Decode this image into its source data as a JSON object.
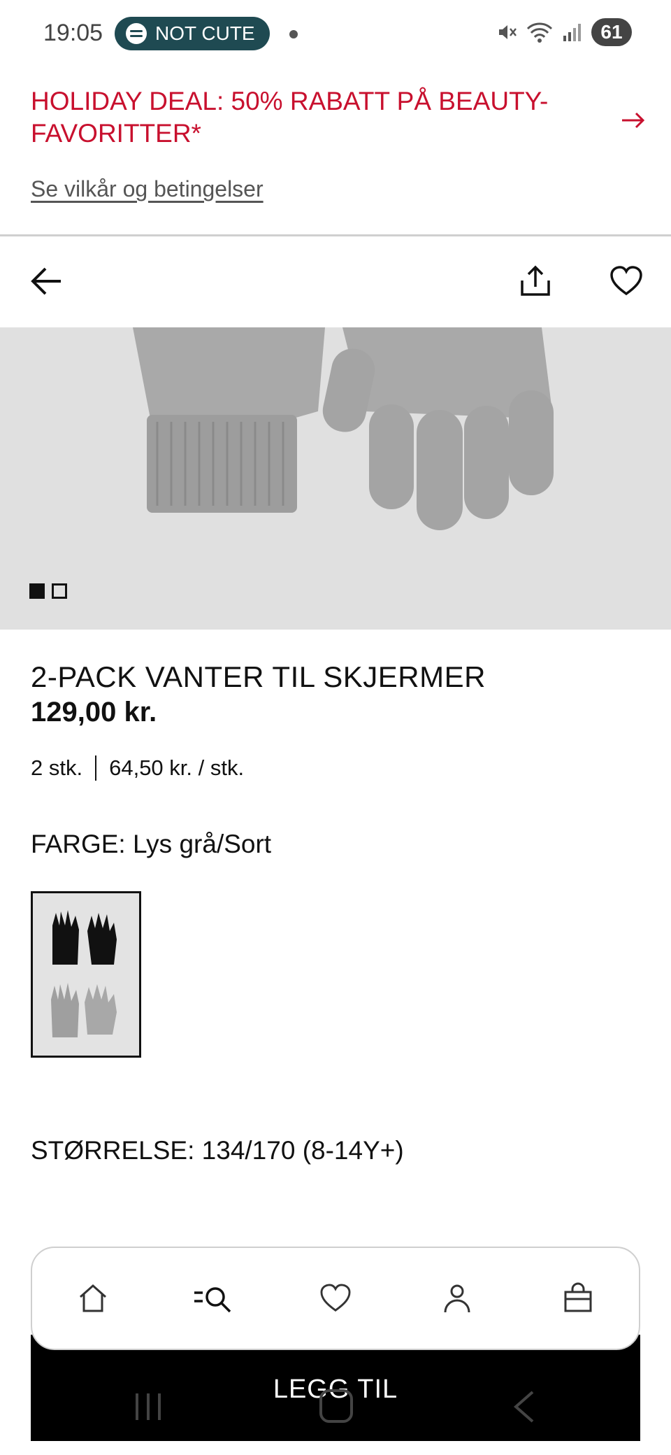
{
  "status_bar": {
    "time": "19:05",
    "media_label": "NOT CUTE",
    "battery_level": "61"
  },
  "promo": {
    "title": "HOLIDAY DEAL: 50% RABATT PÅ BEAUTY-FAVORITTER*",
    "terms_link": "Se vilkår og betingelser",
    "accent_color": "#c8102e"
  },
  "topbar": {
    "back_icon": "arrow-left-icon",
    "share_icon": "share-icon",
    "favorite_icon": "heart-icon"
  },
  "gallery": {
    "image_count": 2,
    "active_index": 0
  },
  "product": {
    "title": "2-PACK VANTER TIL SKJERMER",
    "price": "129,00 kr.",
    "quantity": "2 stk.",
    "unit_price": "64,50 kr. / stk.",
    "color_label": "FARGE: Lys grå/Sort",
    "size_label": "STØRRELSE: 134/170 (8-14Y+)"
  },
  "bottom_nav": {
    "items": [
      {
        "icon": "home-icon"
      },
      {
        "icon": "search-menu-icon"
      },
      {
        "icon": "heart-icon"
      },
      {
        "icon": "account-icon"
      },
      {
        "icon": "shopping-bag-icon"
      }
    ]
  },
  "add_button": {
    "label": "LEGG TIL"
  }
}
